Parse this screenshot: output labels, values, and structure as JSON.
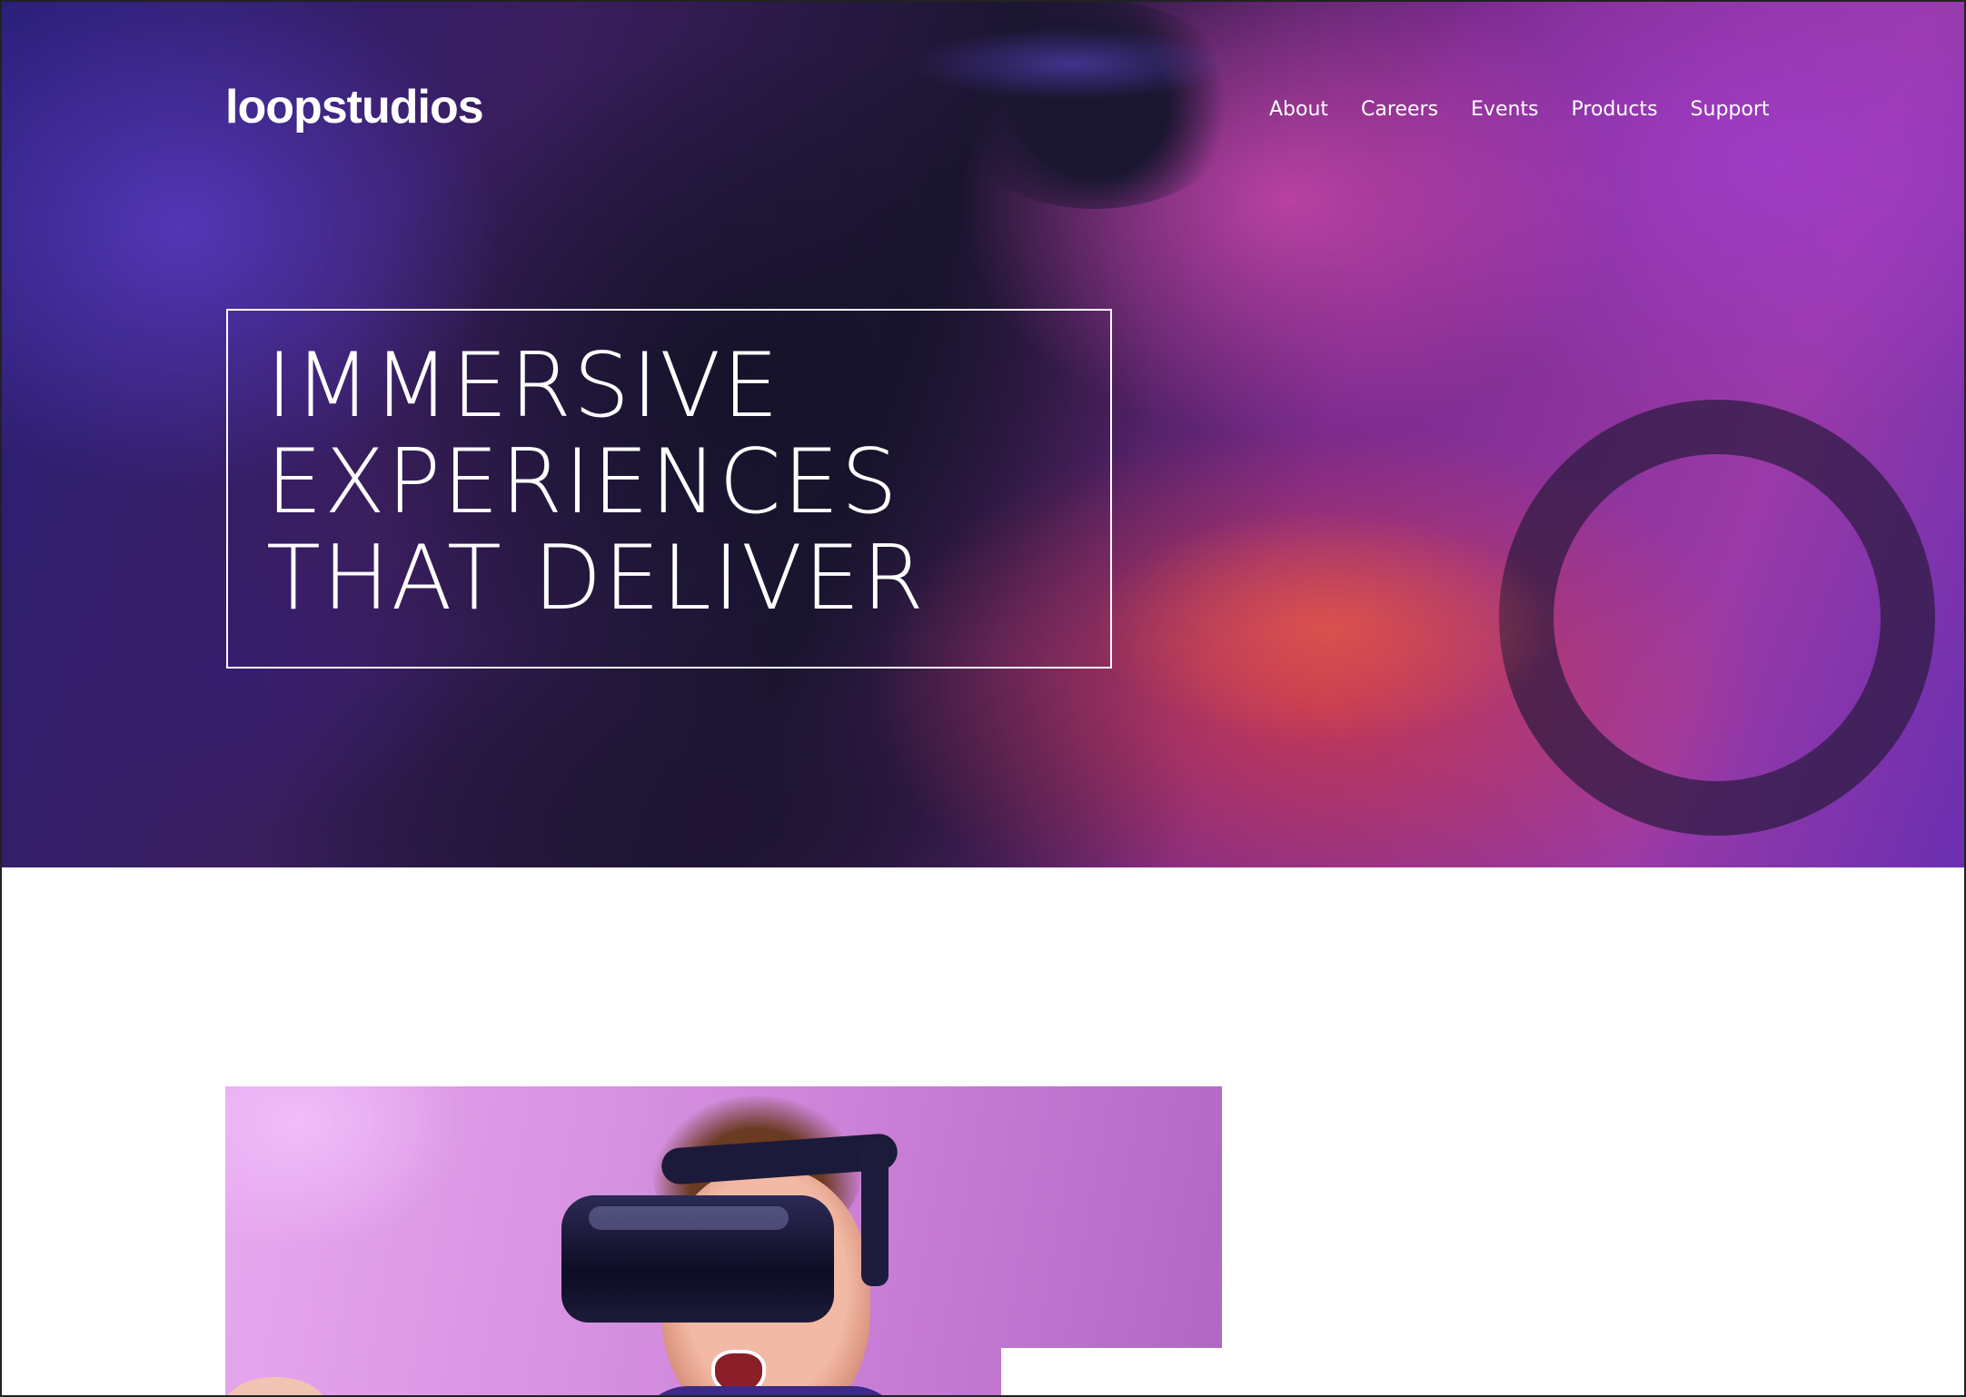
{
  "brand": {
    "logo_text": "loopstudios"
  },
  "nav": {
    "items": [
      {
        "label": "About"
      },
      {
        "label": "Careers"
      },
      {
        "label": "Events"
      },
      {
        "label": "Products"
      },
      {
        "label": "Support"
      }
    ]
  },
  "hero": {
    "headline_lines": [
      "IMMERSIVE",
      "EXPERIENCES",
      "THAT DELIVER"
    ]
  },
  "colors": {
    "hero_text": "#ffffff",
    "hero_purple": "#9a3aa8",
    "hero_blue": "#2a1f7a",
    "feature_bg": "#d690e0",
    "page_bg": "#ffffff"
  },
  "icons": []
}
